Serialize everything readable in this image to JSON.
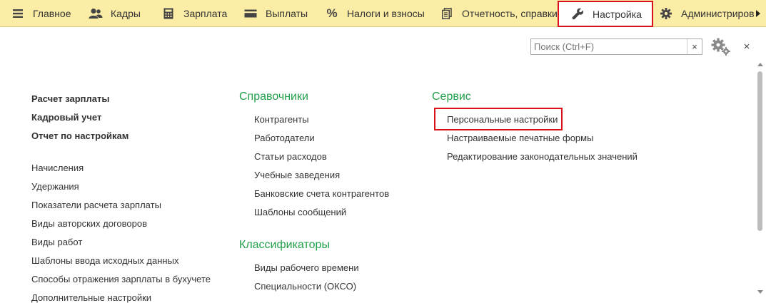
{
  "nav": {
    "tabs": [
      {
        "label": "Главное",
        "icon": "menu-icon"
      },
      {
        "label": "Кадры",
        "icon": "people-icon"
      },
      {
        "label": "Зарплата",
        "icon": "calculator-icon"
      },
      {
        "label": "Выплаты",
        "icon": "wallet-icon"
      },
      {
        "label": "Налоги и взносы",
        "icon": "percent-icon"
      },
      {
        "label": "Отчетность, справки",
        "icon": "documents-icon"
      },
      {
        "label": "Настройка",
        "icon": "wrench-icon",
        "active": true
      },
      {
        "label": "Администриров",
        "icon": "gear-icon"
      }
    ]
  },
  "toolbar": {
    "search_placeholder": "Поиск (Ctrl+F)",
    "clear": "×",
    "close": "×"
  },
  "left": {
    "bold_items": [
      "Расчет зарплаты",
      "Кадровый учет",
      "Отчет по настройкам"
    ],
    "items": [
      "Начисления",
      "Удержания",
      "Показатели расчета зарплаты",
      "Виды авторских договоров",
      "Виды работ",
      "Шаблоны ввода исходных данных",
      "Способы отражения зарплаты в бухучете",
      "Дополнительные настройки"
    ]
  },
  "middle": {
    "section1": "Справочники",
    "items1": [
      "Контрагенты",
      "Работодатели",
      "Статьи расходов",
      "Учебные заведения",
      "Банковские счета контрагентов",
      "Шаблоны сообщений"
    ],
    "section2": "Классификаторы",
    "items2": [
      "Виды рабочего времени",
      "Специальности (ОКСО)"
    ]
  },
  "right": {
    "section": "Сервис",
    "items": [
      "Персональные настройки",
      "Настраиваемые печатные формы",
      "Редактирование законодательных значений"
    ]
  },
  "colors": {
    "accent_green": "#22a04a",
    "highlight_red": "#d9101a",
    "topbar_bg": "#fbeca6"
  }
}
